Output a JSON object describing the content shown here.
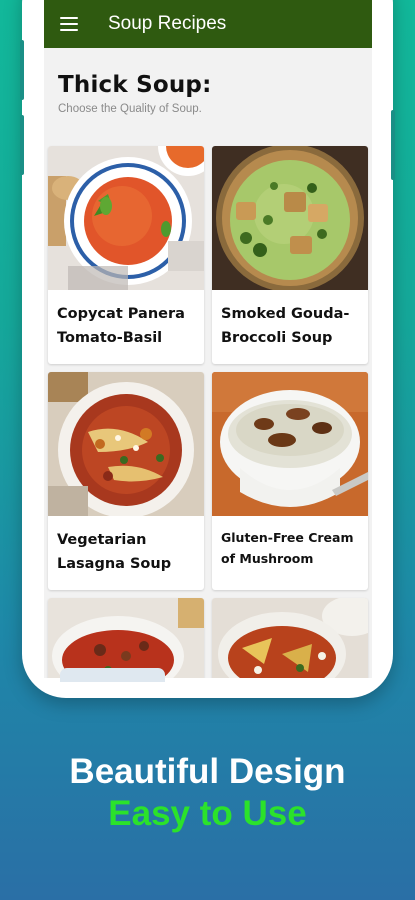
{
  "app": {
    "title": "Soup Recipes"
  },
  "header": {
    "title": "Thick Soup:",
    "subtitle": "Choose the Quality of Soup."
  },
  "recipes": [
    {
      "label": "Copycat Panera Tomato-Basil",
      "icon": "tomato-basil-soup-image"
    },
    {
      "label": "Smoked Gouda-Broccoli Soup",
      "icon": "broccoli-soup-image"
    },
    {
      "label": "Vegetarian Lasagna Soup",
      "icon": "lasagna-soup-image"
    },
    {
      "label": "Gluten-Free Cream of Mushroom",
      "icon": "mushroom-soup-image"
    },
    {
      "label": "",
      "icon": "beef-soup-image"
    },
    {
      "label": "",
      "icon": "tortilla-soup-image"
    }
  ],
  "promo": {
    "line1": "Beautiful Design",
    "line2": "Easy to Use"
  },
  "colors": {
    "appbar": "#2f5a10",
    "promo_line1": "#ffffff",
    "promo_line2": "#2be22b"
  }
}
